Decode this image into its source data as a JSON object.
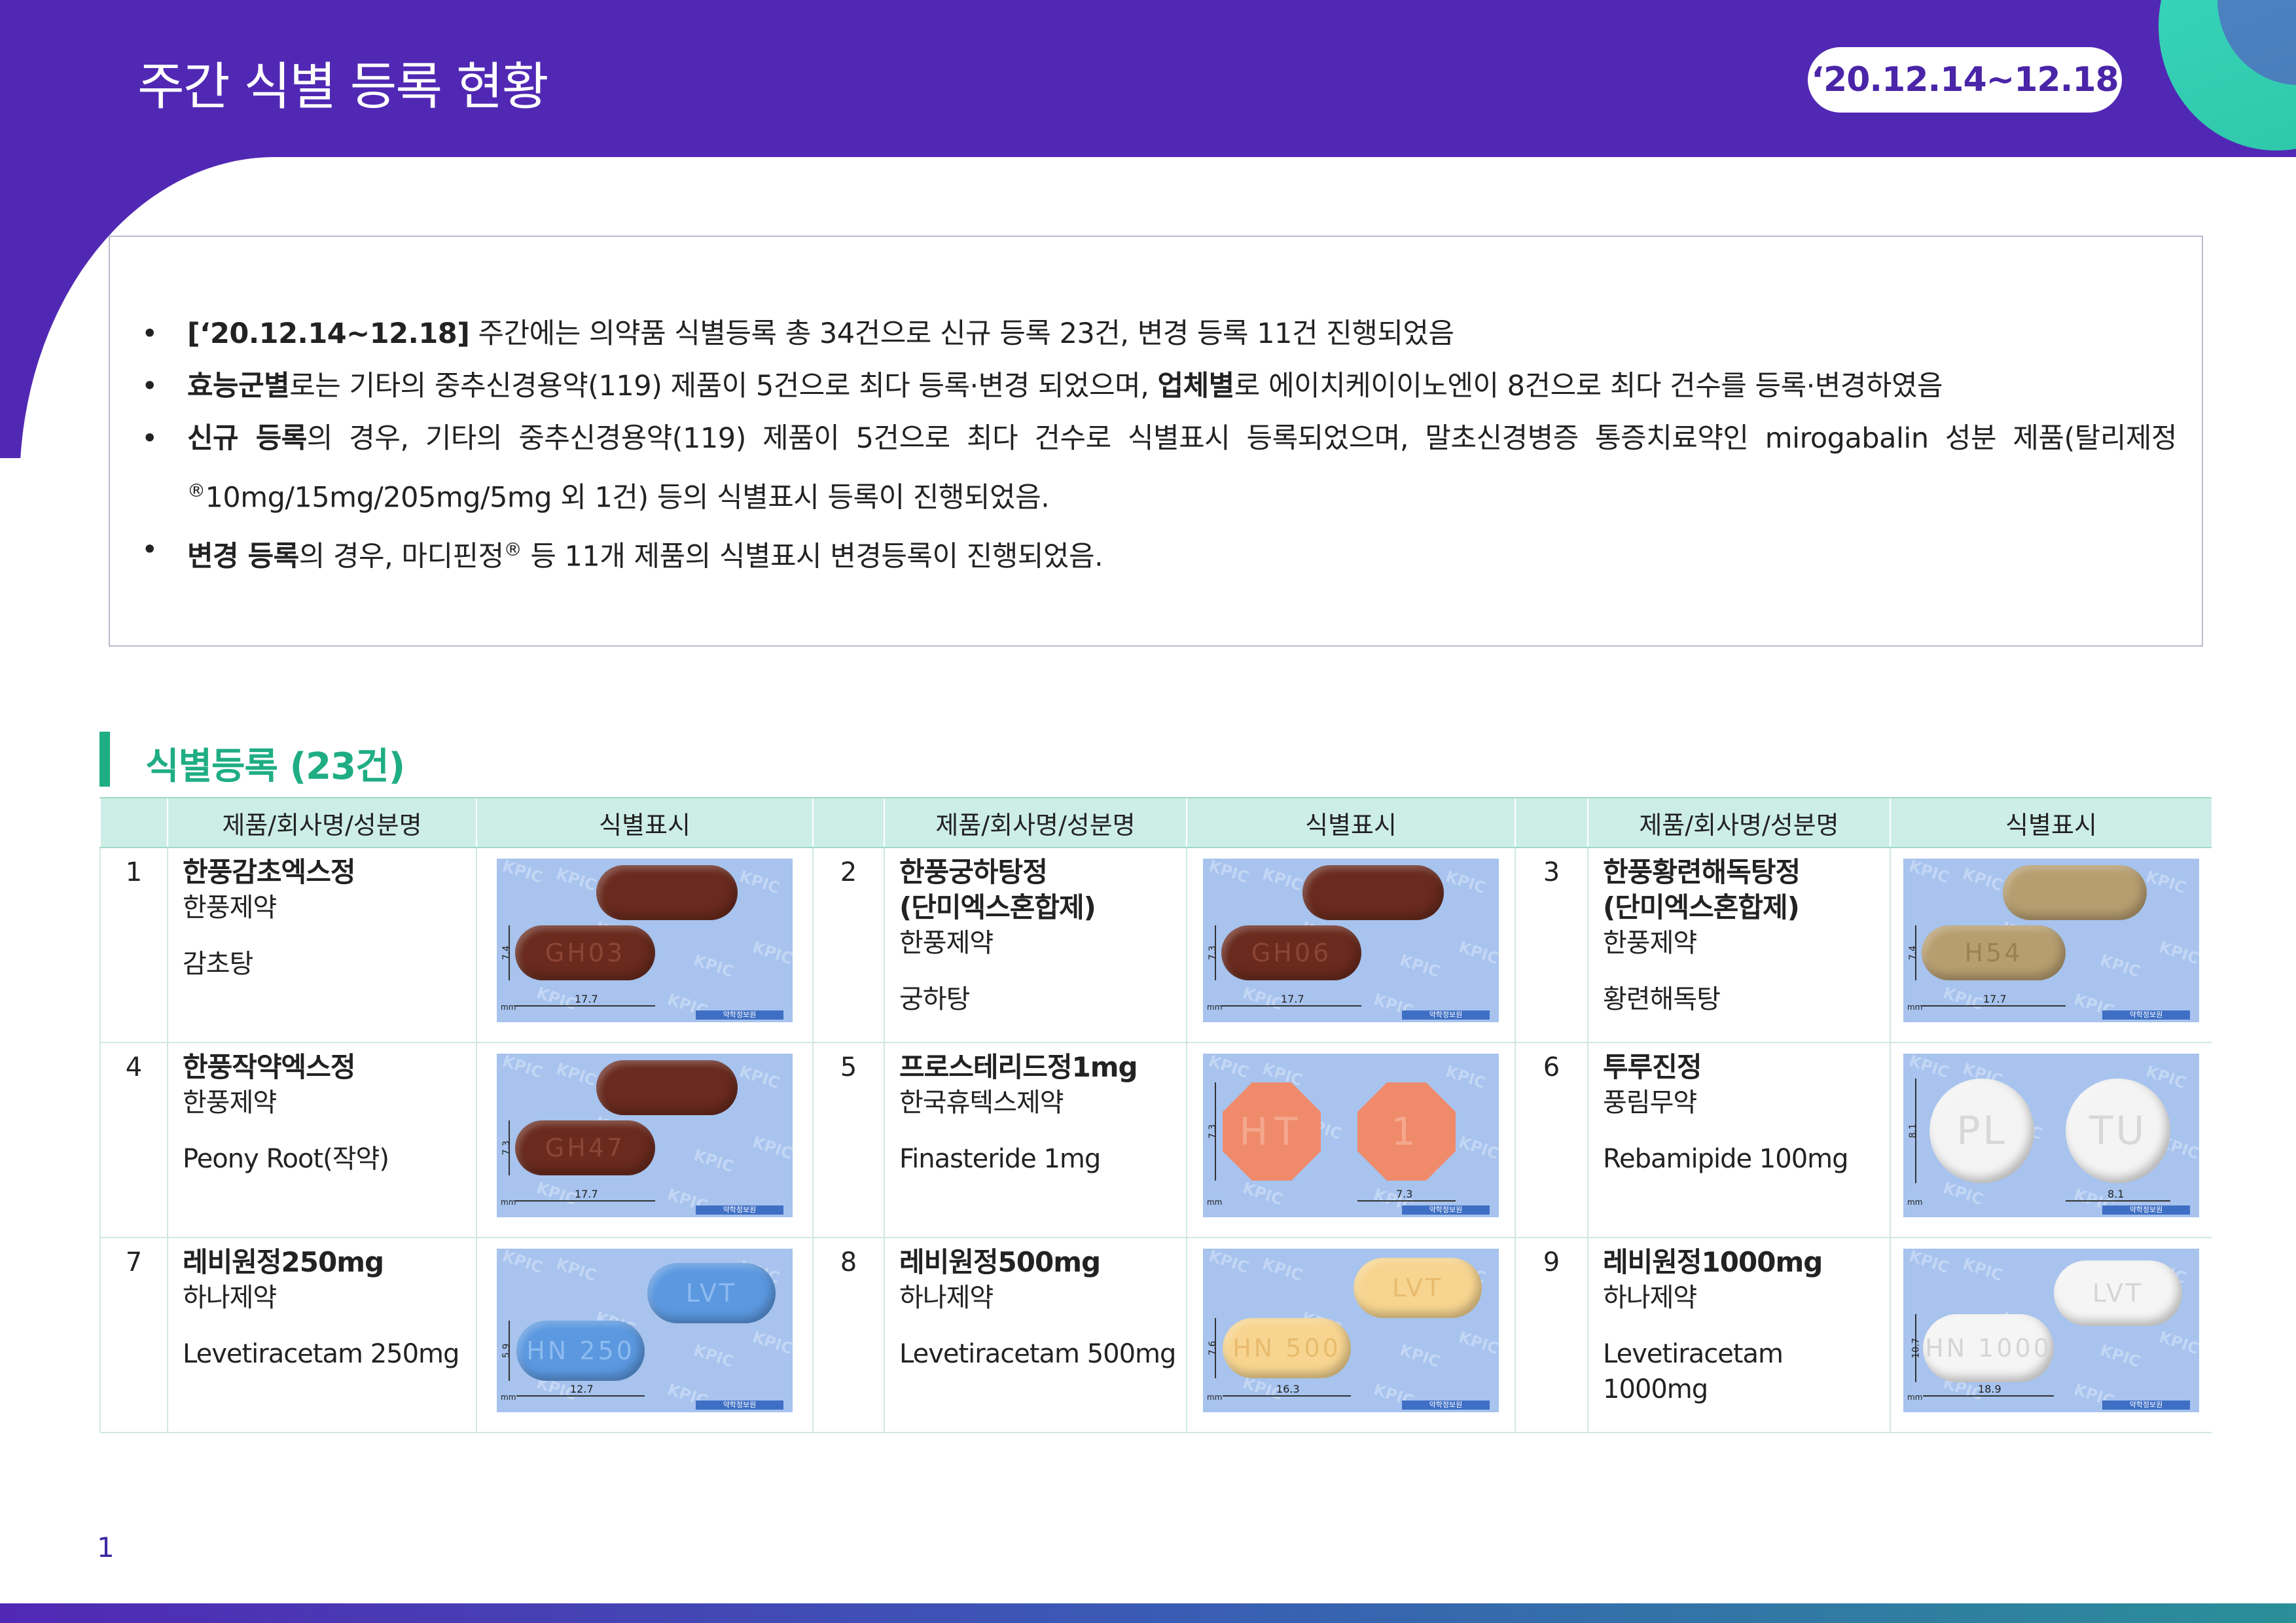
{
  "header": {
    "title": "주간 식별 등록 현황",
    "date_range": "‘20.12.14~12.18"
  },
  "summary": {
    "b1_bold": "[‘20.12.14~12.18]",
    "b1_text": " 주간에는 의약품 식별등록 총 34건으로 신규 등록 23건, 변경 등록 11건 진행되었음",
    "b2_bold1": "효능군별",
    "b2_text1": "로는 기타의 중추신경용약(119) 제품이 5건으로 최다 등록·변경 되었으며, ",
    "b2_bold2": "업체별",
    "b2_text2": "로 에이치케이이노엔이 8건으로 최다 건수를 등록·변경하였음",
    "b3_bold": "신규 등록",
    "b3_text1": "의 경우, 기타의 중추신경용약(119) 제품이 5건으로 최다 건수로 식별표시 등록되었으며, 말초신경병증 통증치료약인 mirogabalin 성분 제품(탈리제정",
    "b3_sup": "®",
    "b3_text2": "10mg/15mg/205mg/5mg 외 1건) 등의 식별표시 등록이 진행되었음.",
    "b4_bold": "변경 등록",
    "b4_text1": "의 경우, 마디핀정",
    "b4_sup": "®",
    "b4_text2": " 등 11개 제품의 식별표시 변경등록이 진행되었음."
  },
  "section": {
    "title": "식별등록 (23건)"
  },
  "table": {
    "col_product": "제품/회사명/성분명",
    "col_marking": "식별표시",
    "items": [
      {
        "no": "1",
        "name": "한풍감초엑스정",
        "company": "한풍제약",
        "ingredient": "감초탕",
        "width_mm": "17.7",
        "height_mm": "7.4",
        "imprint": "GH03",
        "color": "brown"
      },
      {
        "no": "2",
        "name": "한풍궁하탕정\n(단미엑스혼합제)",
        "company": "한풍제약",
        "ingredient": "궁하탕",
        "width_mm": "17.7",
        "height_mm": "7.3",
        "imprint": "GH06",
        "color": "brown"
      },
      {
        "no": "3",
        "name": "한풍황련해독탕정\n(단미엑스혼합제)",
        "company": "한풍제약",
        "ingredient": "황련해독탕",
        "width_mm": "17.7",
        "height_mm": "7.4",
        "imprint": "H54",
        "color": "tan"
      },
      {
        "no": "4",
        "name": "한풍작약엑스정",
        "company": "한풍제약",
        "ingredient": "Peony Root(작약)",
        "width_mm": "17.7",
        "height_mm": "7.3",
        "imprint": "GH47",
        "color": "brown"
      },
      {
        "no": "5",
        "name": "프로스테리드정1mg",
        "company": "한국휴텍스제약",
        "ingredient": "Finasteride 1mg",
        "width_mm": "7.3",
        "height_mm": "7.3",
        "imprint_front": "HT",
        "imprint_back": "1",
        "color": "salmon"
      },
      {
        "no": "6",
        "name": "투루진정",
        "company": "풍림무약",
        "ingredient": "Rebamipide 100mg",
        "width_mm": "8.1",
        "height_mm": "8.1",
        "imprint_front": "PL",
        "imprint_back": "TU",
        "color": "white"
      },
      {
        "no": "7",
        "name": "레비원정250mg",
        "company": "하나제약",
        "ingredient": "Levetiracetam 250mg",
        "width_mm": "12.7",
        "height_mm": "5.9",
        "imprint_front": "HN 250",
        "imprint_back": "LVT",
        "color": "blue"
      },
      {
        "no": "8",
        "name": "레비원정500mg",
        "company": "하나제약",
        "ingredient": "Levetiracetam 500mg",
        "width_mm": "16.3",
        "height_mm": "7.6",
        "imprint_front": "HN 500",
        "imprint_back": "LVT",
        "color": "yellow"
      },
      {
        "no": "9",
        "name": "레비원정1000mg",
        "company": "하나제약",
        "ingredient": "Levetiracetam 1000mg",
        "width_mm": "18.9",
        "height_mm": "10.7",
        "imprint_front": "HN 1000",
        "imprint_back": "LVT",
        "color": "ivory"
      }
    ],
    "scale_unit": "mm",
    "watermark": "KPIC",
    "logo_text": "약학정보원"
  },
  "footer": {
    "page_number": "1"
  },
  "colors": {
    "header_purple": "#5128b4",
    "accent_green": "#1fad84",
    "table_header_bg": "#cdeee6",
    "pill_photo_bg": "#a7c3ee"
  }
}
